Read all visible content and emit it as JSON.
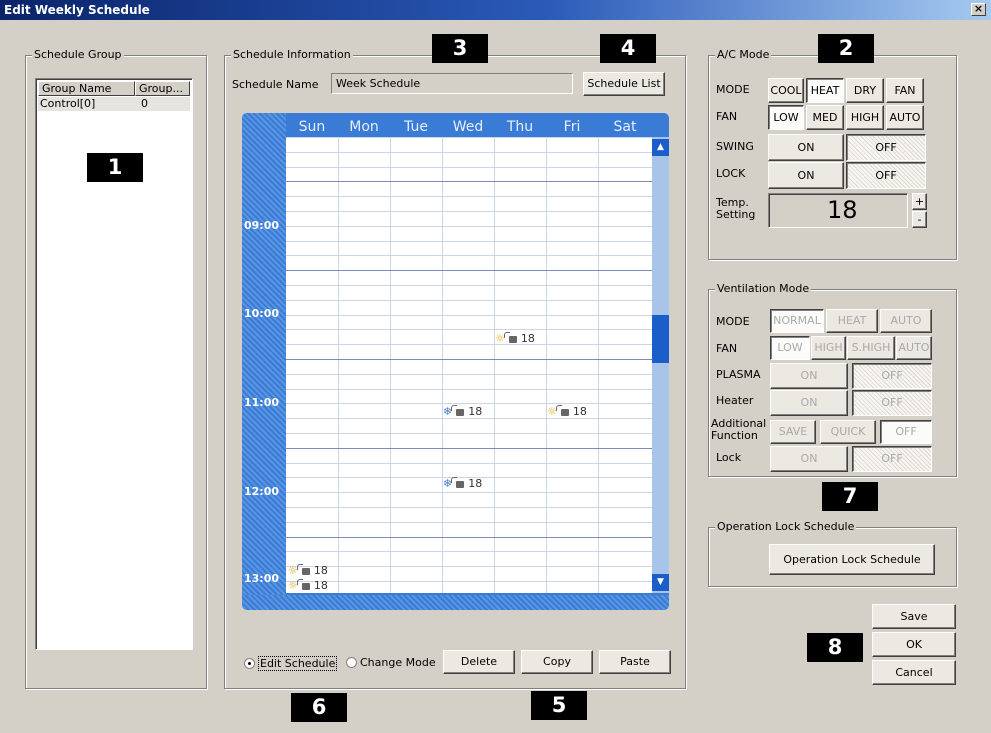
{
  "window": {
    "title": "Edit Weekly Schedule",
    "close_glyph": "×"
  },
  "badges": [
    "1",
    "2",
    "3",
    "4",
    "5",
    "6",
    "7",
    "8"
  ],
  "schedule_group": {
    "legend": "Schedule Group",
    "columns": [
      "Group Name",
      "Group..."
    ],
    "rows": [
      {
        "name": "Control[0]",
        "group": "0"
      }
    ]
  },
  "schedule_info": {
    "legend": "Schedule Information",
    "name_label": "Schedule Name",
    "name_value": "Week Schedule",
    "list_button": "Schedule List",
    "days": [
      "Sun",
      "Mon",
      "Tue",
      "Wed",
      "Thu",
      "Fri",
      "Sat"
    ],
    "times": [
      "09:00",
      "10:00",
      "11:00",
      "12:00",
      "13:00"
    ],
    "entries": [
      {
        "day": "Thu",
        "icon": "sun-icon",
        "lock": true,
        "temp": "18"
      },
      {
        "day": "Wed",
        "icon": "snowflake-icon",
        "lock": true,
        "temp": "18"
      },
      {
        "day": "Fri",
        "icon": "sun-icon",
        "lock": true,
        "temp": "18"
      },
      {
        "day": "Wed",
        "icon": "snowflake-icon",
        "lock": true,
        "temp": "18"
      },
      {
        "day": "Sun",
        "icon": "sun-icon",
        "lock": true,
        "temp": "18"
      },
      {
        "day": "Sun",
        "icon": "sun-icon",
        "lock": true,
        "temp": "18"
      }
    ],
    "scroll_up": "▲",
    "scroll_down": "▼"
  },
  "bottom_controls": {
    "radio_edit": "Edit Schedule",
    "radio_change": "Change Mode",
    "selected": "Edit Schedule",
    "delete": "Delete",
    "copy": "Copy",
    "paste": "Paste"
  },
  "ac_mode": {
    "legend": "A/C Mode",
    "mode_label": "MODE",
    "mode_options": [
      "COOL",
      "HEAT",
      "DRY",
      "FAN"
    ],
    "mode_selected": "HEAT",
    "fan_label": "FAN",
    "fan_options": [
      "LOW",
      "MED",
      "HIGH",
      "AUTO"
    ],
    "fan_selected": "LOW",
    "swing_label": "SWING",
    "swing_on": "ON",
    "swing_off": "OFF",
    "swing_selected": "OFF",
    "lock_label": "LOCK",
    "lock_on": "ON",
    "lock_off": "OFF",
    "lock_selected": "OFF",
    "temp_label_1": "Temp.",
    "temp_label_2": "Setting",
    "temp_value": "18",
    "plus": "+",
    "minus": "-"
  },
  "ventilation_mode": {
    "legend": "Ventilation Mode",
    "mode_label": "MODE",
    "mode_options": [
      "NORMAL",
      "HEAT",
      "AUTO"
    ],
    "fan_label": "FAN",
    "fan_options": [
      "LOW",
      "HIGH",
      "S.HIGH",
      "AUTO"
    ],
    "plasma_label": "PLASMA",
    "heater_label": "Heater",
    "additional_label_1": "Additional",
    "additional_label_2": "Function",
    "additional_options": [
      "SAVE",
      "QUICK",
      "OFF"
    ],
    "lock_label": "Lock",
    "on": "ON",
    "off": "OFF"
  },
  "operation_lock": {
    "legend": "Operation Lock Schedule",
    "button": "Operation Lock Schedule"
  },
  "dialog_buttons": {
    "save": "Save",
    "ok": "OK",
    "cancel": "Cancel"
  }
}
